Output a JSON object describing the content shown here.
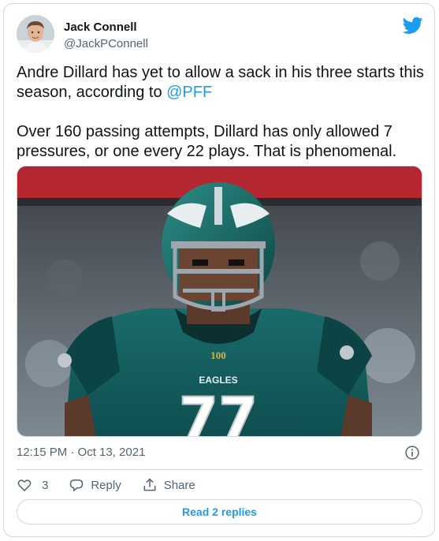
{
  "user": {
    "name": "Jack Connell",
    "handle": "@JackPConnell"
  },
  "tweet": {
    "text_line1_before": "Andre Dillard has yet to allow a sack in his three starts this season, according to ",
    "mention": "@PFF",
    "text_para2": "Over 160 passing attempts, Dillard has only allowed 7 pressures, or one every 22 plays. That is phenomenal.",
    "timestamp": "12:15 PM · Oct 13, 2021"
  },
  "media": {
    "jersey_number": "77",
    "jersey_wordmark": "EAGLES",
    "patch": "100"
  },
  "actions": {
    "likes_count": "3",
    "reply_label": "Reply",
    "share_label": "Share",
    "read_replies_label": "Read 2 replies"
  },
  "colors": {
    "accent": "#1d9bf0",
    "text": "#0f1419",
    "muted": "#536471",
    "border": "#cfd9de",
    "eagles_green": "#1f6f6b"
  },
  "icons": {
    "brand": "twitter-bird-icon",
    "info": "info-icon",
    "like": "heart-icon",
    "reply": "reply-icon",
    "share": "share-icon"
  }
}
